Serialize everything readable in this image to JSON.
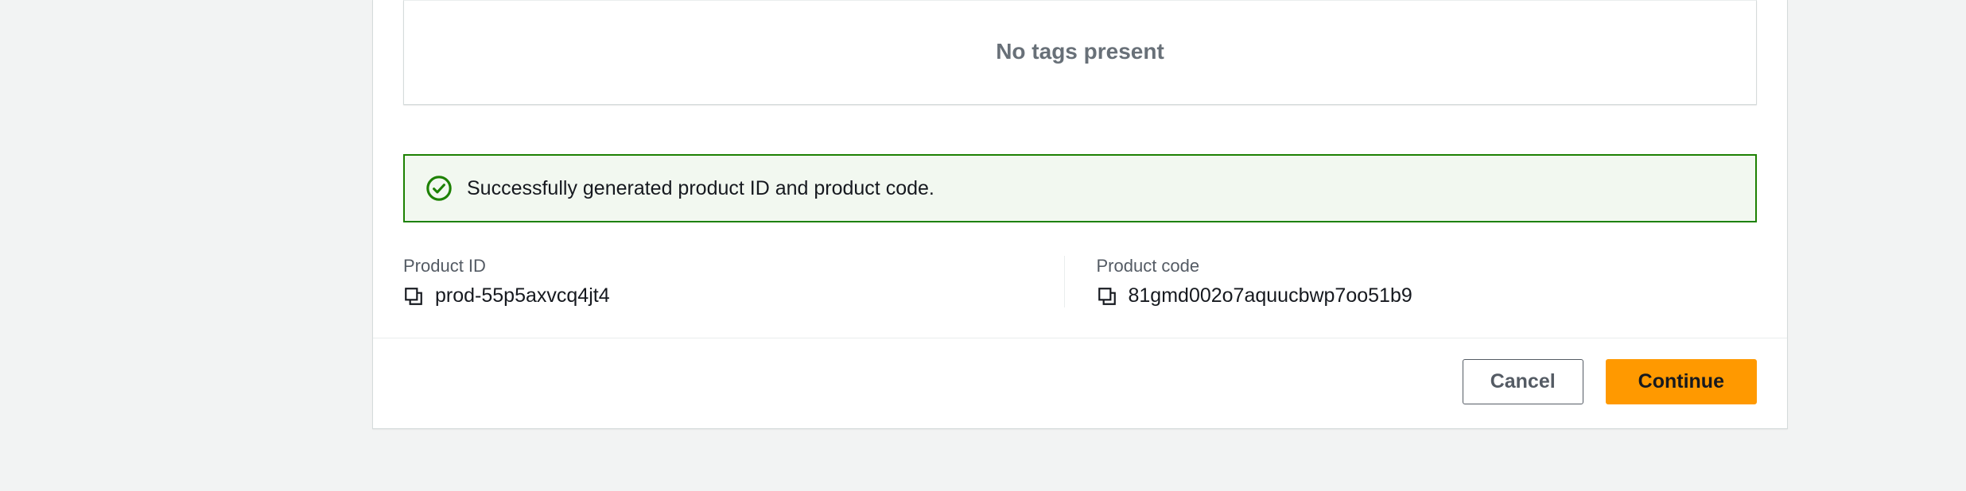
{
  "tags": {
    "empty_text": "No tags present"
  },
  "alert": {
    "message": "Successfully generated product ID and product code."
  },
  "details": {
    "product_id": {
      "label": "Product ID",
      "value": "prod-55p5axvcq4jt4"
    },
    "product_code": {
      "label": "Product code",
      "value": "81gmd002o7aquucbwp7oo51b9"
    }
  },
  "actions": {
    "cancel": "Cancel",
    "continue": "Continue"
  }
}
